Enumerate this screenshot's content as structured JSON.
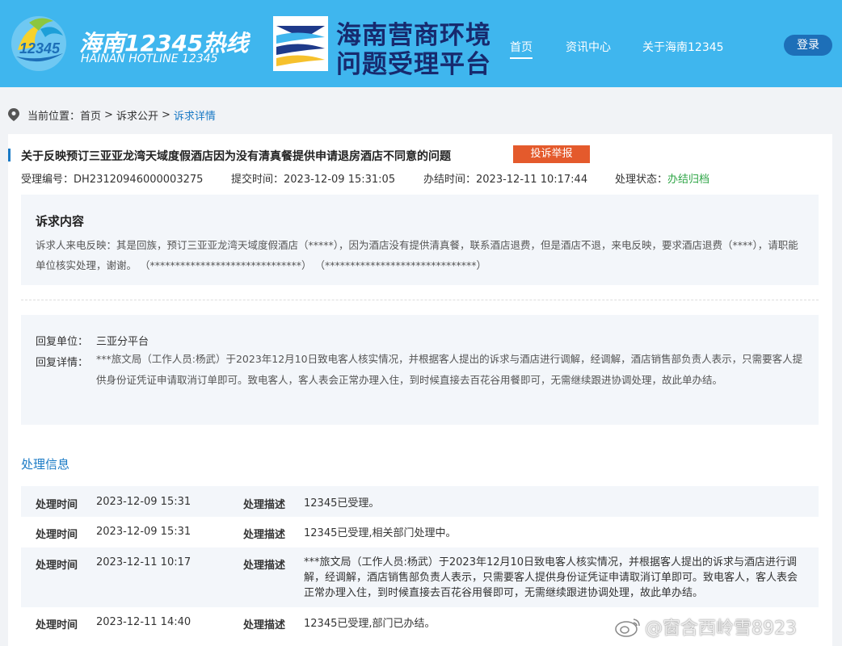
{
  "header": {
    "logo1_title": "海南12345热线",
    "logo1_sub": "HAINAN HOTLINE 12345",
    "logo1_badge": "12345",
    "logo2_line1": "海南营商环境",
    "logo2_line2": "问题受理平台",
    "nav": [
      "首页",
      "资讯中心",
      "关于海南12345"
    ],
    "login_label": "登录",
    "colors": {
      "header_bg": "#3fb6ee",
      "login_bg": "#1d6fb8"
    }
  },
  "breadcrumb": {
    "prefix": "当前位置：",
    "items": [
      "首页",
      "诉求公开",
      "诉求详情"
    ],
    "sep": ">"
  },
  "case": {
    "title": "关于反映预订三亚亚龙湾天域度假酒店因为没有清真餐提供申请退房酒店不同意的问题",
    "report_label": "投诉举报",
    "id_label": "受理编号：",
    "id_value": "DH23120946000003275",
    "submit_label": "提交时间：",
    "submit_value": "2023-12-09 15:31:05",
    "done_label": "办结时间：",
    "done_value": "2023-12-11 10:17:44",
    "status_label": "处理状态：",
    "status_value": "办结归档"
  },
  "request": {
    "heading": "诉求内容",
    "text": "诉求人来电反映：其是回族，预订三亚亚龙湾天域度假酒店（*****），因为酒店没有提供清真餐，联系酒店退费，但是酒店不退，来电反映，要求酒店退费（****），请职能单位核实处理，谢谢。 （******************************） （******************************）"
  },
  "reply": {
    "unit_label": "回复单位：",
    "unit_value": "三亚分平台",
    "detail_label": "回复详情：",
    "detail_value": "***旅文局（工作人员:杨武）于2023年12月10日致电客人核实情况，并根据客人提出的诉求与酒店进行调解，经调解，酒店销售部负责人表示，只需要客人提供身份证凭证申请取消订单即可。致电客人，客人表会正常办理入住，到时候直接去百花谷用餐即可，无需继续跟进协调处理，故此单办结。"
  },
  "process": {
    "heading": "处理信息",
    "time_label": "处理时间",
    "desc_label": "处理描述",
    "rows": [
      {
        "time": "2023-12-09 15:31",
        "desc": "12345已受理。"
      },
      {
        "time": "2023-12-09 15:31",
        "desc": "12345已受理,相关部门处理中。"
      },
      {
        "time": "2023-12-11 10:17",
        "desc": "***旅文局（工作人员:杨武）于2023年12月10日致电客人核实情况，并根据客人提出的诉求与酒店进行调解，经调解，酒店销售部负责人表示，只需要客人提供身份证凭证申请取消订单即可。致电客人，客人表会正常办理入住，到时候直接去百花谷用餐即可，无需继续跟进协调处理，故此单办结。"
      },
      {
        "time": "2023-12-11 14:40",
        "desc": "12345已受理,部门已办结。"
      }
    ]
  },
  "watermark": "@窗含西岭雪8923"
}
